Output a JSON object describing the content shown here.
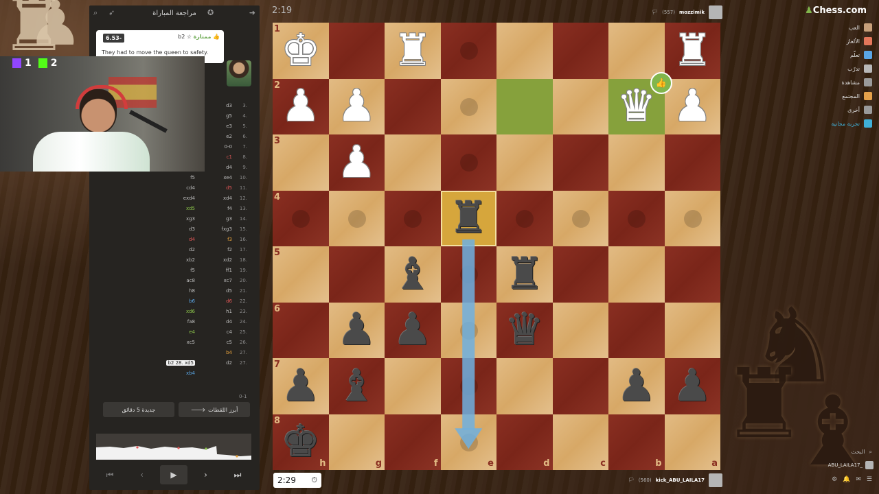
{
  "review": {
    "title": "مراجعة المباراة",
    "feedback": {
      "eval": "6.53-",
      "move": "b2",
      "quality": "ممتازة",
      "text": "They had to move the queen to safety."
    },
    "key_moments_btn": "أبرز اللقطات",
    "new_game_btn": "جديدة 5 دقائق",
    "result_text": "0-1"
  },
  "stream": {
    "platform_a_score": "1",
    "platform_b_score": "2"
  },
  "moves": [
    {
      "n": "3.",
      "w": "",
      "b": "d3"
    },
    {
      "n": "4.",
      "w": "",
      "b": "g5"
    },
    {
      "n": "5.",
      "w": "",
      "b": "e3"
    },
    {
      "n": "6.",
      "w": "",
      "b": "e2"
    },
    {
      "n": "7.",
      "w": "",
      "b": "0-0"
    },
    {
      "n": "8.",
      "w": "",
      "b": "c1",
      "bc": "bad"
    },
    {
      "n": "9.",
      "w": "dxe4",
      "b": "d4"
    },
    {
      "n": "10.",
      "w": "f5",
      "b": "xe4"
    },
    {
      "n": "11.",
      "w": "cd4",
      "b": "d5",
      "bc": "bad"
    },
    {
      "n": "12.",
      "w": "exd4",
      "b": "xd4"
    },
    {
      "n": "13.",
      "w": "xd5",
      "wc": "good",
      "b": "f4"
    },
    {
      "n": "14.",
      "w": "xg3",
      "b": "g3"
    },
    {
      "n": "15.",
      "w": "d3",
      "b": "fxg3"
    },
    {
      "n": "16.",
      "w": "d4",
      "wc": "bad",
      "b": "f3",
      "bc": "orange"
    },
    {
      "n": "17.",
      "w": "d2",
      "b": "f2"
    },
    {
      "n": "18.",
      "w": "xb2",
      "b": "xd2"
    },
    {
      "n": "19.",
      "w": "f5",
      "b": "ff1"
    },
    {
      "n": "20.",
      "w": "ac8",
      "b": "xc7"
    },
    {
      "n": "21.",
      "w": "h8",
      "b": "d5"
    },
    {
      "n": "22.",
      "w": "b6",
      "wc": "blue",
      "b": "d6",
      "bc": "bad"
    },
    {
      "n": "23.",
      "w": "xd6",
      "wc": "good",
      "b": "h1"
    },
    {
      "n": "24.",
      "w": "fa8",
      "b": "d4"
    },
    {
      "n": "25.",
      "w": "e4",
      "wc": "good",
      "b": "c4"
    },
    {
      "n": "26.",
      "w": "xc5",
      "b": "c5"
    },
    {
      "n": "27.",
      "w": "",
      "b": "b4",
      "bc": "orange"
    },
    {
      "n": "27.",
      "w": "b2 28.  xd5",
      "wc": "hl",
      "b": "d2"
    },
    {
      "n": "",
      "w": "xb4",
      "wc": "blue",
      "b": ""
    }
  ],
  "game": {
    "timer_top": "2:19",
    "clock_bottom": "2:29",
    "opponent": {
      "name": "mozzimik",
      "rating": "(557)"
    },
    "player": {
      "name": "kick_ABU_LAILA17",
      "rating": "(560)"
    }
  },
  "board": {
    "ranks": [
      "1",
      "2",
      "3",
      "4",
      "5",
      "6",
      "7",
      "8"
    ],
    "files": [
      "h",
      "g",
      "f",
      "e",
      "d",
      "c",
      "b",
      "a"
    ],
    "pieces": [
      {
        "c": 0,
        "r": 0,
        "color": "w",
        "type": "♚"
      },
      {
        "c": 2,
        "r": 0,
        "color": "w",
        "type": "♜"
      },
      {
        "c": 7,
        "r": 0,
        "color": "w",
        "type": "♜"
      },
      {
        "c": 0,
        "r": 1,
        "color": "w",
        "type": "♟"
      },
      {
        "c": 1,
        "r": 1,
        "color": "w",
        "type": "♟"
      },
      {
        "c": 6,
        "r": 1,
        "color": "w",
        "type": "♛"
      },
      {
        "c": 7,
        "r": 1,
        "color": "w",
        "type": "♟"
      },
      {
        "c": 1,
        "r": 2,
        "color": "w",
        "type": "♟"
      },
      {
        "c": 3,
        "r": 3,
        "color": "b",
        "type": "♜"
      },
      {
        "c": 2,
        "r": 4,
        "color": "b",
        "type": "♝"
      },
      {
        "c": 4,
        "r": 4,
        "color": "b",
        "type": "♜"
      },
      {
        "c": 1,
        "r": 5,
        "color": "b",
        "type": "♟"
      },
      {
        "c": 2,
        "r": 5,
        "color": "b",
        "type": "♟"
      },
      {
        "c": 4,
        "r": 5,
        "color": "b",
        "type": "♛"
      },
      {
        "c": 0,
        "r": 6,
        "color": "b",
        "type": "♟"
      },
      {
        "c": 1,
        "r": 6,
        "color": "b",
        "type": "♝"
      },
      {
        "c": 6,
        "r": 6,
        "color": "b",
        "type": "♟"
      },
      {
        "c": 7,
        "r": 6,
        "color": "b",
        "type": "♟"
      },
      {
        "c": 0,
        "r": 7,
        "color": "b",
        "type": "♚"
      }
    ],
    "dots": [
      [
        3,
        0
      ],
      [
        3,
        1
      ],
      [
        3,
        2
      ],
      [
        0,
        3
      ],
      [
        1,
        3
      ],
      [
        2,
        3
      ],
      [
        4,
        3
      ],
      [
        5,
        3
      ],
      [
        6,
        3
      ],
      [
        7,
        3
      ],
      [
        3,
        4
      ],
      [
        3,
        5
      ],
      [
        3,
        6
      ],
      [
        3,
        7
      ]
    ],
    "green": [
      [
        4,
        1
      ],
      [
        6,
        1
      ]
    ],
    "selected": [
      3,
      3
    ],
    "arrow": {
      "from": [
        3,
        3
      ],
      "to": [
        3,
        7
      ]
    }
  },
  "nav": {
    "logo": "Chess.com",
    "items": [
      {
        "label": "العب",
        "color": "#c7a07a"
      },
      {
        "label": "الألغاز",
        "color": "#e4775a"
      },
      {
        "label": "تعلّم",
        "color": "#5aa6e6"
      },
      {
        "label": "تدرّب",
        "color": "#b8b8b8"
      },
      {
        "label": "مشاهدة",
        "color": "#9a9a9a"
      },
      {
        "label": "المجتمع",
        "color": "#e5a14a"
      },
      {
        "label": "أخرى",
        "color": "#9a9a9a"
      },
      {
        "label": "تجربة مجانية",
        "color": "#3fb0d8"
      }
    ],
    "search": "البحث",
    "user": "ABU_LAILA17_"
  },
  "colors": {
    "green_highlight": "#86a13c",
    "arrow": "#6fb0e0",
    "accent": "#81b64c"
  }
}
